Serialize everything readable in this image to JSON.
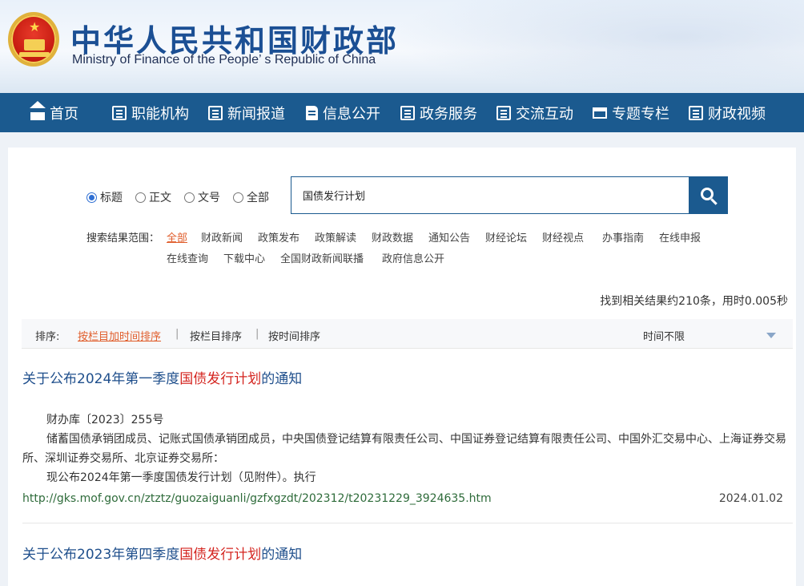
{
  "header": {
    "title_cn": "中华人民共和国财政部",
    "title_en": "Ministry of Finance of the People’ s Republic of China",
    "emblem_icon": "national-emblem"
  },
  "nav": [
    {
      "label": "首页",
      "icon": "home-icon"
    },
    {
      "label": "职能机构",
      "icon": "list-icon"
    },
    {
      "label": "新闻报道",
      "icon": "news-icon"
    },
    {
      "label": "信息公开",
      "icon": "document-icon"
    },
    {
      "label": "政务服务",
      "icon": "edit-icon"
    },
    {
      "label": "交流互动",
      "icon": "chat-icon"
    },
    {
      "label": "专题专栏",
      "icon": "window-icon"
    },
    {
      "label": "财政视频",
      "icon": "video-icon"
    }
  ],
  "search": {
    "options": [
      "标题",
      "正文",
      "文号",
      "全部"
    ],
    "selected": "标题",
    "query": "国债发行计划",
    "scope_label": "搜索结果范围：",
    "scopes": [
      "全部",
      "财政新闻",
      "政策发布",
      "政策解读",
      "财政数据",
      "通知公告",
      "财经论坛",
      "财经视点",
      "办事指南",
      "在线申报",
      "在线查询",
      "下载中心",
      "全国财政新闻联播",
      "政府信息公开"
    ],
    "active_scope": "全部"
  },
  "stats": "找到相关结果约210条，用时0.005秒",
  "sort": {
    "label": "排序:",
    "options": [
      "按栏目加时间排序",
      "按栏目排序",
      "按时间排序"
    ],
    "active": "按栏目加时间排序",
    "time_filter": "时间不限"
  },
  "results": [
    {
      "title_pre": "关于公布2024年第一季度",
      "title_hl": "国债发行计划",
      "title_post": "的通知",
      "snippet_lines": [
        "财办库〔2023〕255号",
        "储蓄国债承销团成员、记账式国债承销团成员，中央国债登记结算有限责任公司、中国证券登记结算有限责任公司、中国外汇交易中心、上海证券交易所、深圳证券交易所、北京证券交易所：",
        "现公布2024年第一季度国债发行计划（见附件）。执行"
      ],
      "url": "http://gks.mof.gov.cn/ztztz/guozaiguanli/gzfxgzdt/202312/t20231229_3924635.htm",
      "date": "2024.01.02"
    },
    {
      "title_pre": "关于公布2023年第四季度",
      "title_hl": "国债发行计划",
      "title_post": "的通知"
    }
  ],
  "colors": {
    "nav_bg": "#1b5a8f",
    "highlight": "#d4241f",
    "active_link": "#e05d2b",
    "title_blue": "#1f4f8c",
    "url_green": "#2e6b3a"
  }
}
